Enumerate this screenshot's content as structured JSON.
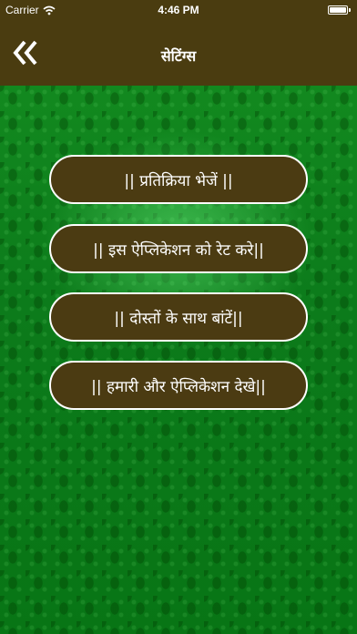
{
  "status_bar": {
    "carrier": "Carrier",
    "time": "4:46 PM",
    "battery_level": 1.0
  },
  "nav": {
    "title": "सेटिंग्स",
    "back_icon": "double-chevron-left-icon"
  },
  "menu": {
    "items": [
      {
        "label": "|| प्रतिक्रिया भेजें ||"
      },
      {
        "label": "|| इस ऐप्लिकेशन को रेट करे||"
      },
      {
        "label": "|| दोस्तों के साथ बांटें||"
      },
      {
        "label": "|| हमारी और ऐप्लिकेशन देखे||"
      }
    ]
  },
  "colors": {
    "nav_background": "#4a3c10",
    "button_background": "#4b3b12",
    "content_background": "#0f7d1e",
    "text": "#ffffff"
  }
}
